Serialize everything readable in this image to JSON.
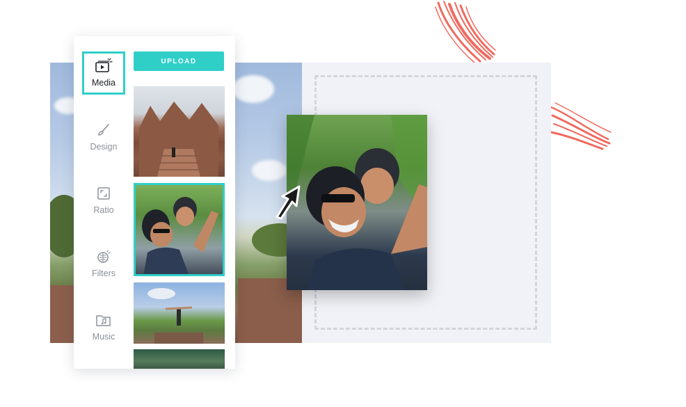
{
  "sidebar": {
    "items": [
      {
        "label": "Media",
        "icon": "media-icon",
        "active": true
      },
      {
        "label": "Design",
        "icon": "brush-icon",
        "active": false
      },
      {
        "label": "Ratio",
        "icon": "ratio-icon",
        "active": false
      },
      {
        "label": "Filters",
        "icon": "filters-icon",
        "active": false
      },
      {
        "label": "Music",
        "icon": "music-folder-icon",
        "active": false
      }
    ]
  },
  "media": {
    "upload_label": "UPLOAD",
    "thumbnails": [
      {
        "subject": "temple-stairs",
        "selected": false
      },
      {
        "subject": "couple-selfie",
        "selected": true
      },
      {
        "subject": "person-arms-outstretched",
        "selected": false
      },
      {
        "subject": "greenery",
        "selected": false
      }
    ]
  },
  "colors": {
    "accent": "#2fcfc8",
    "deco": "#ef5a4e",
    "drop_panel": "#f0f2f7"
  }
}
